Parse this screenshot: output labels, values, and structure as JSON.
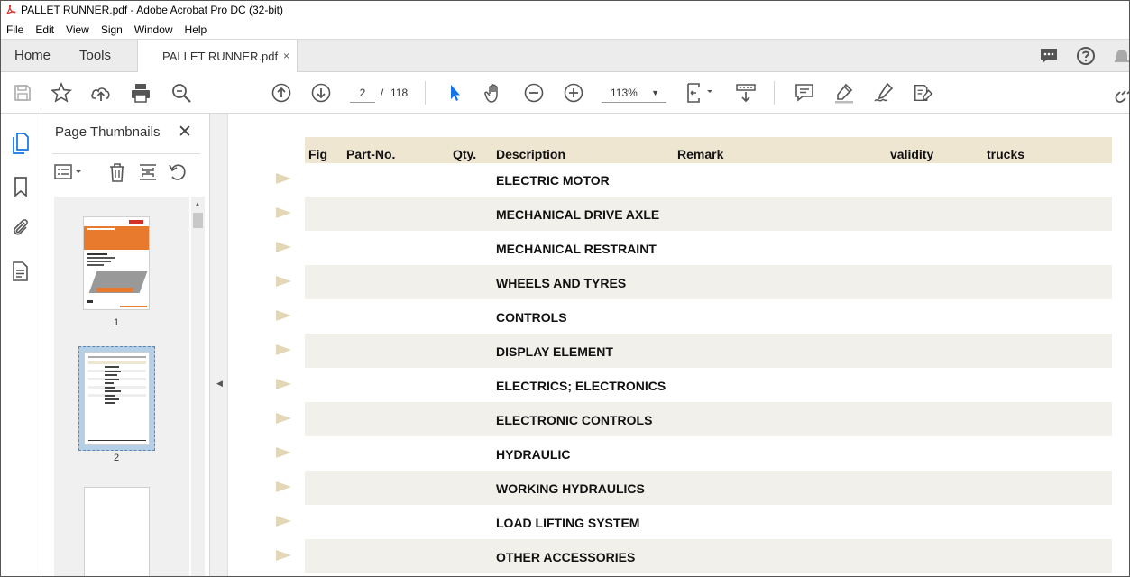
{
  "window": {
    "title": "PALLET RUNNER.pdf - Adobe Acrobat Pro DC (32-bit)"
  },
  "menu": [
    "File",
    "Edit",
    "View",
    "Sign",
    "Window",
    "Help"
  ],
  "tabs": {
    "home": "Home",
    "tools": "Tools",
    "document": "PALLET RUNNER.pdf",
    "close": "×"
  },
  "toolbar": {
    "current_page": "2",
    "page_separator": "/",
    "total_pages": "118",
    "zoom": "113%",
    "icons": [
      "save-icon",
      "star-icon",
      "upload-icon",
      "print-icon",
      "zoom-search-icon",
      "page-up-icon",
      "page-down-icon",
      "select-cursor-icon",
      "hand-icon",
      "zoom-out-icon",
      "zoom-in-icon",
      "page-fit-icon",
      "scroll-mode-icon",
      "comment-icon",
      "highlight-icon",
      "sign-icon",
      "fill-sign-icon",
      "link-icon"
    ]
  },
  "panel": {
    "title": "Page Thumbnails",
    "close": "✕",
    "thumbnails": [
      {
        "label": "1"
      },
      {
        "label": "2",
        "selected": true
      },
      {
        "label": ""
      }
    ]
  },
  "document": {
    "columns": [
      "Fig",
      "Part-No.",
      "Qty.",
      "Description",
      "Remark",
      "validity",
      "trucks"
    ],
    "rows": [
      "ELECTRIC MOTOR",
      "MECHANICAL DRIVE AXLE",
      "MECHANICAL RESTRAINT",
      "WHEELS AND TYRES",
      "CONTROLS",
      "DISPLAY ELEMENT",
      "ELECTRICS; ELECTRONICS",
      "ELECTRONIC CONTROLS",
      "HYDRAULIC",
      "WORKING HYDRAULICS",
      "LOAD LIFTING SYSTEM",
      "OTHER ACCESSORIES"
    ]
  },
  "colors": {
    "header_bg": "#efe6d2",
    "row_shade": "#f1f0ea",
    "marker": "#e3d7b8",
    "accent_blue": "#1473e6",
    "acrobat_red": "#d4312b"
  }
}
